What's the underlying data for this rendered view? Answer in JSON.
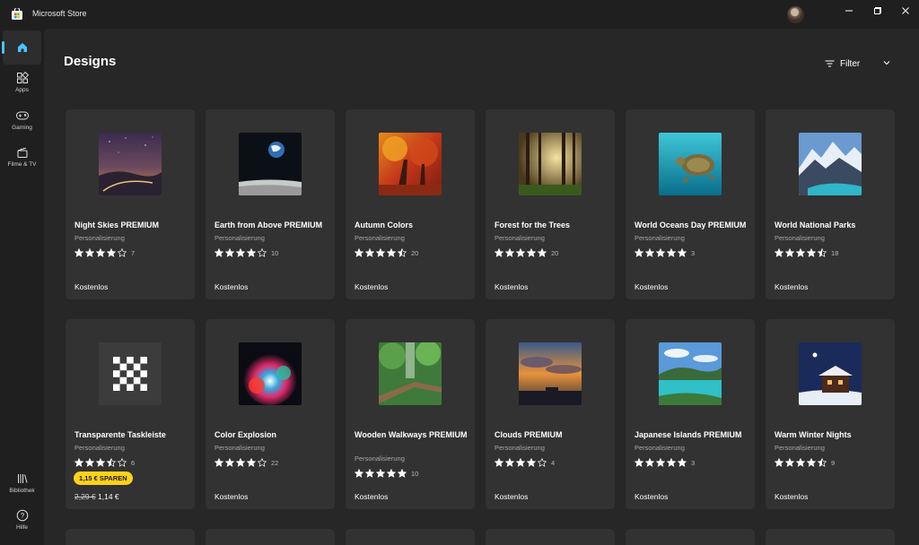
{
  "titlebar": {
    "app_title": "Microsoft Store",
    "icons": {
      "app": "store-icon",
      "avatar": "user-avatar",
      "minimize": "minimize-icon",
      "maximize": "maximize-icon",
      "close": "close-icon"
    }
  },
  "sidebar": {
    "items": [
      {
        "label": "",
        "icon": "home-icon",
        "active": true
      },
      {
        "label": "Apps",
        "icon": "apps-icon"
      },
      {
        "label": "Gaming",
        "icon": "gamepad-icon"
      },
      {
        "label": "Filme & TV",
        "icon": "film-icon"
      },
      {
        "label": "Bibliothek",
        "icon": "library-icon"
      },
      {
        "label": "Hilfe",
        "icon": "help-icon"
      }
    ]
  },
  "page": {
    "title": "Designs",
    "filter_label": "Filter",
    "filter_icon": "filter-icon"
  },
  "accent": "#4cc2ff",
  "sale_color": "#ffd21a",
  "cards": [
    {
      "title": "Night Skies PREMIUM",
      "category": "Personalisierung",
      "rating": 4,
      "count": "7",
      "price": "Kostenlos"
    },
    {
      "title": "Earth from Above PREMIUM",
      "category": "Personalisierung",
      "rating": 4,
      "count": "10",
      "price": "Kostenlos"
    },
    {
      "title": "Autumn Colors",
      "category": "Personalisierung",
      "rating": 4.5,
      "count": "20",
      "price": "Kostenlos"
    },
    {
      "title": "Forest for the Trees",
      "category": "Personalisierung",
      "rating": 5,
      "count": "20",
      "price": "Kostenlos"
    },
    {
      "title": "World Oceans Day PREMIUM",
      "category": "Personalisierung",
      "rating": 5,
      "count": "3",
      "price": "Kostenlos"
    },
    {
      "title": "World National Parks",
      "category": "Personalisierung",
      "rating": 4.5,
      "count": "18",
      "price": "Kostenlos"
    },
    {
      "title": "Transparente Taskleiste",
      "category": "Personalisierung",
      "rating": 3.5,
      "count": "6",
      "badge": "1,15 € SPAREN",
      "old_price": "2,29 €",
      "price": "1,14 €"
    },
    {
      "title": "Color Explosion",
      "category": "Personalisierung",
      "rating": 4,
      "count": "22",
      "price": "Kostenlos"
    },
    {
      "title": "Wooden Walkways PREMIUM",
      "category": "Personalisierung",
      "rating": 5,
      "count": "10",
      "price": "Kostenlos"
    },
    {
      "title": "Clouds PREMIUM",
      "category": "Personalisierung",
      "rating": 4,
      "count": "4",
      "price": "Kostenlos"
    },
    {
      "title": "Japanese Islands PREMIUM",
      "category": "Personalisierung",
      "rating": 5,
      "count": "3",
      "price": "Kostenlos"
    },
    {
      "title": "Warm Winter Nights",
      "category": "Personalisierung",
      "rating": 4.5,
      "count": "9",
      "price": "Kostenlos"
    }
  ]
}
